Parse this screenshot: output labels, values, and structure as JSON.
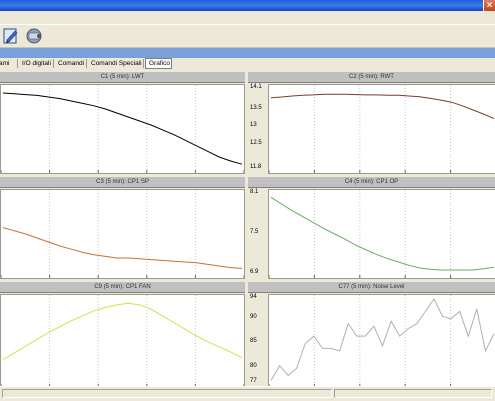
{
  "window": {
    "close_glyph": "×",
    "title_color": "#1f5ed8"
  },
  "toolbar": {
    "icons": [
      "edit-icon",
      "settings-icon"
    ]
  },
  "tabs": [
    {
      "label": "ami",
      "active": false
    },
    {
      "label": "I/O digitali",
      "active": false
    },
    {
      "label": "Comandi",
      "active": false
    },
    {
      "label": "Comandi Speciali",
      "active": false
    },
    {
      "label": "Grafico",
      "active": true
    }
  ],
  "chart_data": [
    {
      "type": "line",
      "title": "C1 (5 min): LWT",
      "color": "#000000",
      "yticks": [],
      "ylim": [
        0,
        1
      ],
      "values": [
        0.95,
        0.94,
        0.93,
        0.92,
        0.9,
        0.88,
        0.85,
        0.82,
        0.79,
        0.75,
        0.7,
        0.65,
        0.6,
        0.55,
        0.49,
        0.43,
        0.36,
        0.29,
        0.22,
        0.15,
        0.1,
        0.06
      ]
    },
    {
      "type": "line",
      "title": "C2 (5 min): RWT",
      "color": "#7a3b2e",
      "yticks": [
        "14.1",
        "13.5",
        "13",
        "12.5",
        "11.8"
      ],
      "ylim": [
        11.8,
        14.1
      ],
      "values": [
        13.85,
        13.87,
        13.9,
        13.92,
        13.93,
        13.95,
        13.95,
        13.95,
        13.94,
        13.93,
        13.93,
        13.92,
        13.92,
        13.9,
        13.88,
        13.83,
        13.78,
        13.72,
        13.62,
        13.5,
        13.38,
        13.25
      ]
    },
    {
      "type": "line",
      "title": "C3 (5 min): CP1 SP",
      "color": "#c8703a",
      "yticks": [],
      "ylim": [
        0,
        1
      ],
      "values": [
        0.58,
        0.54,
        0.5,
        0.45,
        0.4,
        0.35,
        0.31,
        0.27,
        0.24,
        0.22,
        0.2,
        0.2,
        0.19,
        0.18,
        0.17,
        0.16,
        0.15,
        0.14,
        0.12,
        0.1,
        0.08,
        0.07
      ]
    },
    {
      "type": "line",
      "title": "C4 (5 min): CP1 OP",
      "color": "#6aaa66",
      "yticks": [
        "8.1",
        "7.5",
        "6.9"
      ],
      "ylim": [
        6.9,
        8.1
      ],
      "values": [
        8.05,
        7.95,
        7.85,
        7.76,
        7.67,
        7.58,
        7.5,
        7.42,
        7.33,
        7.26,
        7.19,
        7.13,
        7.08,
        7.03,
        6.99,
        6.97,
        6.96,
        6.96,
        6.96,
        6.96,
        6.98,
        7.0
      ]
    },
    {
      "type": "line",
      "title": "C9 (5 min): CP1 FAN",
      "color": "#d6e04a",
      "yticks": [],
      "ylim": [
        0,
        1
      ],
      "values": [
        0.28,
        0.36,
        0.44,
        0.52,
        0.6,
        0.67,
        0.74,
        0.8,
        0.86,
        0.9,
        0.93,
        0.95,
        0.93,
        0.88,
        0.8,
        0.72,
        0.64,
        0.56,
        0.49,
        0.43,
        0.37,
        0.3
      ]
    },
    {
      "type": "line",
      "title": "C77 (5 min): Noise Level",
      "color": "#b0b0b0",
      "yticks": [
        "94",
        "90",
        "85",
        "80",
        "77"
      ],
      "ylim": [
        77,
        94
      ],
      "values": [
        77.5,
        80.5,
        78.5,
        80,
        85,
        86.5,
        84,
        84,
        83.5,
        89,
        86.5,
        86.5,
        88.5,
        84.5,
        89.5,
        86.5,
        88,
        89,
        91.5,
        94,
        90.5,
        90,
        91.5,
        86.5,
        92,
        83.5,
        87
      ]
    }
  ],
  "panel_titles": [
    "C1 (5 min): LWT",
    "C2 (5 min): RWT",
    "C3 (5 min): CP1 SP",
    "C4 (5 min): CP1 OP",
    "C9 (5 min): CP1 FAN",
    "C77 (5 min): Noise Level"
  ]
}
